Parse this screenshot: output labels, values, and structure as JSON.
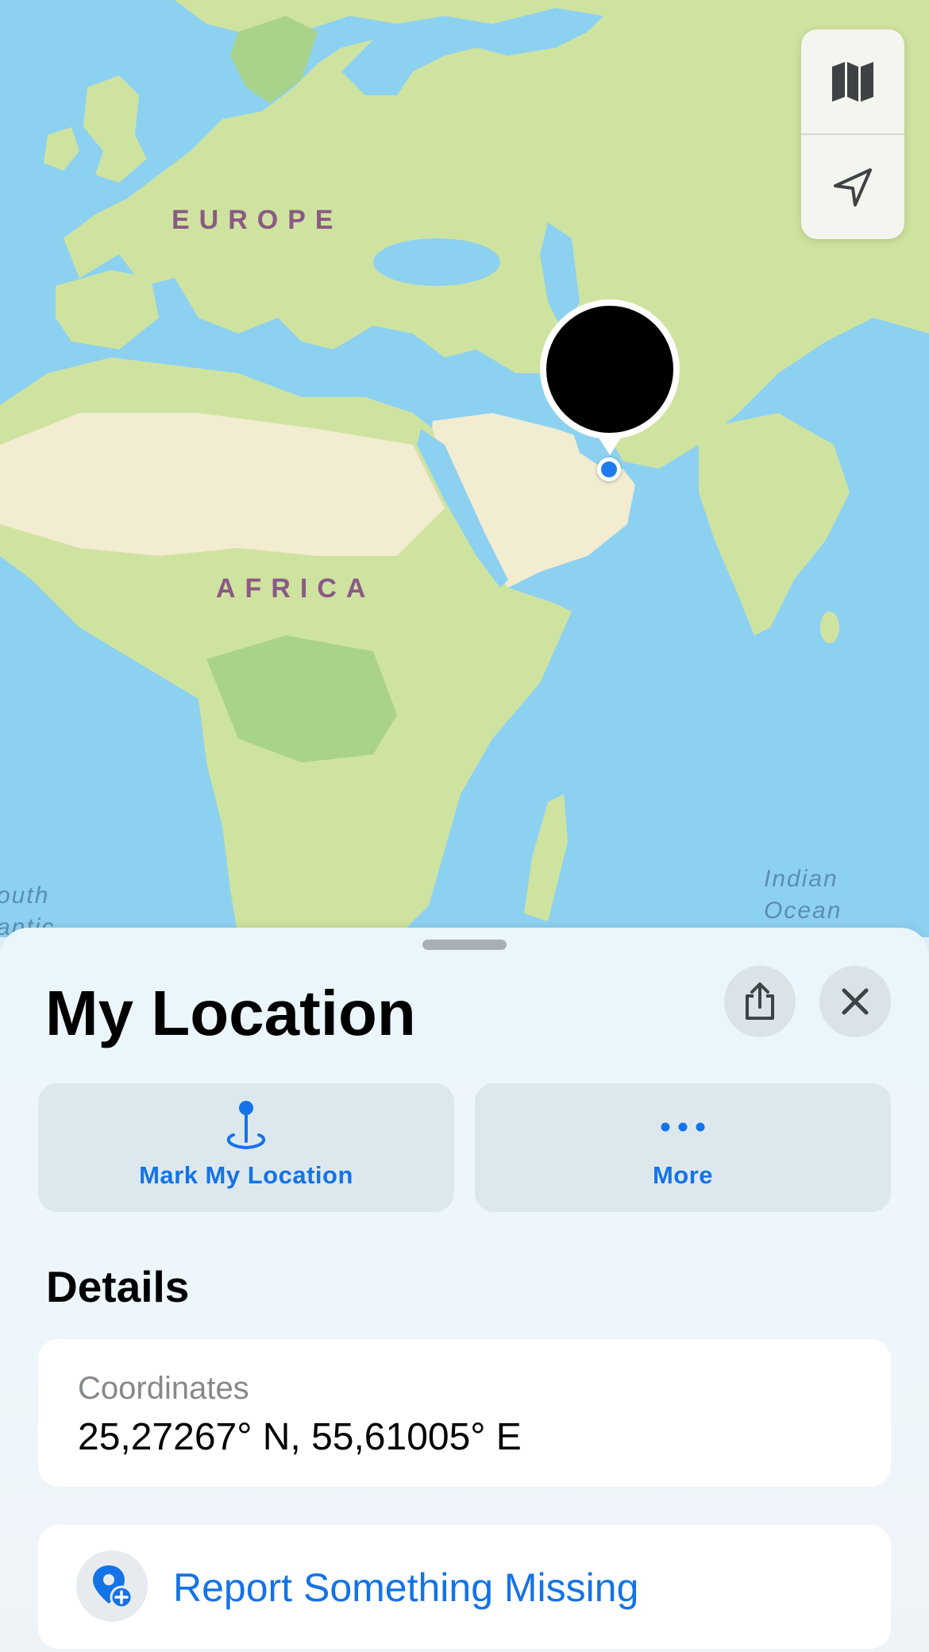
{
  "map": {
    "labels": {
      "europe": "EUROPE",
      "africa": "AFRICA"
    },
    "ocean_labels": {
      "indian_line1": "Indian",
      "indian_line2": "Ocean",
      "atlantic_line1": "outh",
      "atlantic_line2": "antic"
    },
    "controls": {
      "map_mode_icon": "map-icon",
      "locate_icon": "location-arrow-icon"
    },
    "colors": {
      "water": "#8dd1f1",
      "land": "#cfe3a0",
      "forest": "#a9d38a",
      "desert": "#f2ecd1",
      "user_dot": "#1e7cf0"
    }
  },
  "sheet": {
    "title": "My Location",
    "share_icon": "share-icon",
    "close_icon": "close-icon",
    "actions": [
      {
        "label": "Mark My Location",
        "icon": "pin-icon"
      },
      {
        "label": "More",
        "icon": "ellipsis-icon"
      }
    ],
    "details_title": "Details",
    "coordinates": {
      "label": "Coordinates",
      "value": "25,27267° N, 55,61005° E"
    },
    "report": {
      "label": "Report Something Missing",
      "icon": "map-pin-plus-icon"
    },
    "accent_color": "#1473e6"
  }
}
